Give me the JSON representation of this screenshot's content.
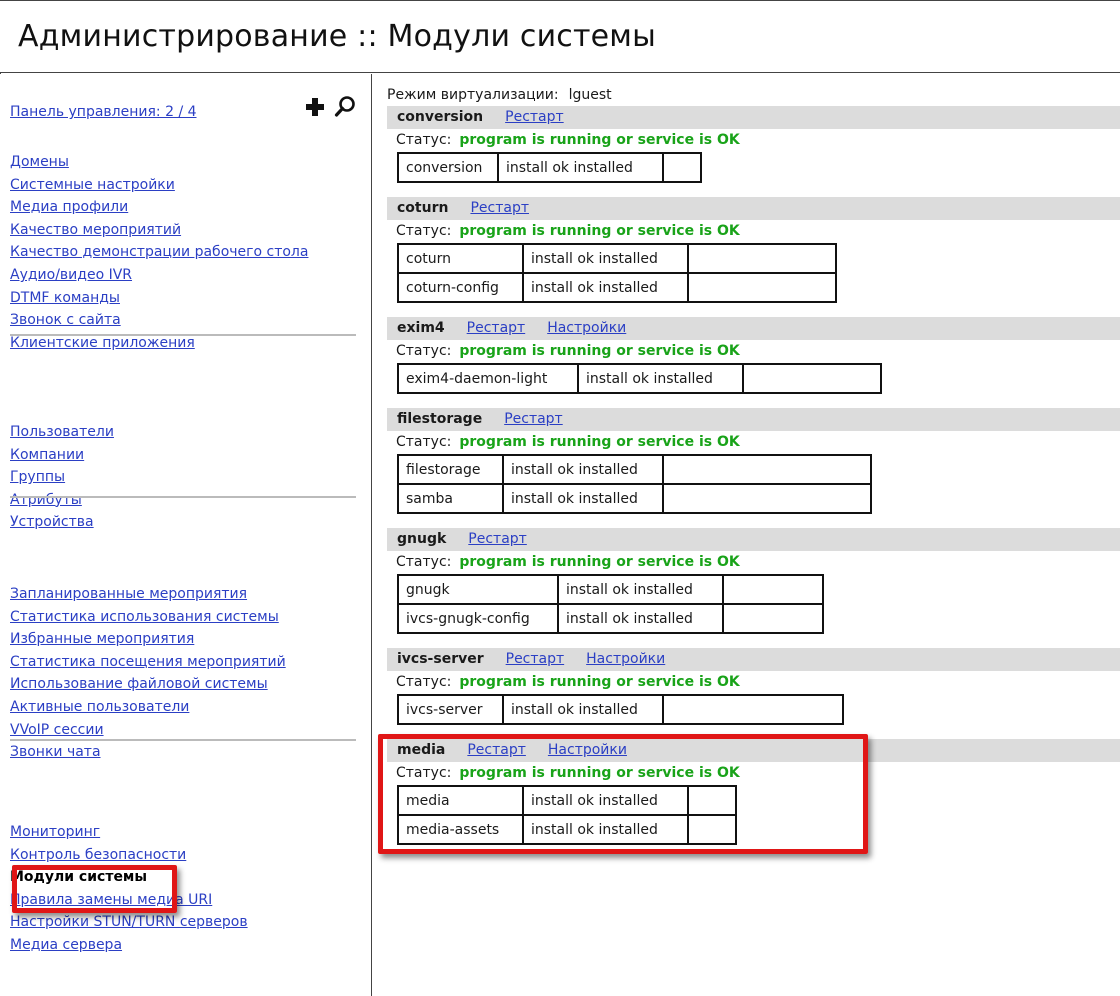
{
  "header": {
    "title": "Администрирование :: Модули системы"
  },
  "sidebar": {
    "panel_link": "Панель управления: 2 / 4",
    "groups": [
      [
        "Домены",
        "Системные настройки",
        "Медиа профили",
        "Качество мероприятий",
        "Качество демонстрации рабочего стола",
        "Аудио/видео IVR",
        "DTMF команды",
        "Звонок с сайта",
        "Клиентские приложения"
      ],
      [
        "Пользователи",
        "Компании",
        "Группы",
        "Атрибуты",
        "Устройства"
      ],
      [
        "Запланированные мероприятия",
        "Статистика использования системы",
        "Избранные мероприятия",
        "Статистика посещения мероприятий",
        "Использование файловой системы",
        "Активные пользователи",
        "VVoIP сессии",
        "Звонки чата"
      ],
      [
        "Мониторинг",
        "Контроль безопасности",
        "Модули системы",
        "Правила замены медиа URI",
        "Настройки STUN/TURN серверов",
        "Медиа сервера"
      ]
    ],
    "active_item": "Модули системы"
  },
  "main": {
    "virt_label": "Режим виртуализации:",
    "virt_value": "lguest",
    "status_label": "Статус:",
    "restart_label": "Рестарт",
    "settings_label": "Настройки",
    "modules": [
      {
        "name": "conversion",
        "settings": false,
        "status": "program is running or service is OK",
        "packages": [
          [
            "conversion",
            "install ok installed",
            ""
          ]
        ]
      },
      {
        "name": "coturn",
        "settings": false,
        "status": "program is running or service is OK",
        "packages": [
          [
            "coturn",
            "install ok installed",
            ""
          ],
          [
            "coturn-config",
            "install ok installed",
            ""
          ]
        ]
      },
      {
        "name": "exim4",
        "settings": true,
        "status": "program is running or service is OK",
        "packages": [
          [
            "exim4-daemon-light",
            "install ok installed",
            ""
          ]
        ]
      },
      {
        "name": "filestorage",
        "settings": false,
        "status": "program is running or service is OK",
        "packages": [
          [
            "filestorage",
            "install ok installed",
            ""
          ],
          [
            "samba",
            "install ok installed",
            ""
          ]
        ]
      },
      {
        "name": "gnugk",
        "settings": false,
        "status": "program is running or service is OK",
        "packages": [
          [
            "gnugk",
            "install ok installed",
            ""
          ],
          [
            "ivcs-gnugk-config",
            "install ok installed",
            ""
          ]
        ]
      },
      {
        "name": "ivcs-server",
        "settings": true,
        "status": "program is running or service is OK",
        "packages": [
          [
            "ivcs-server",
            "install ok installed",
            ""
          ]
        ]
      },
      {
        "name": "media",
        "settings": true,
        "status": "program is running or service is OK",
        "packages": [
          [
            "media",
            "install ok installed",
            ""
          ],
          [
            "media-assets",
            "install ok installed",
            ""
          ]
        ]
      }
    ]
  },
  "colors": {
    "link": "#2b3fc4",
    "ok": "#19a319",
    "highlight": "#e01616",
    "module_header_bg": "#dcdcdc"
  },
  "icons": [
    "plus-icon",
    "search-icon"
  ]
}
